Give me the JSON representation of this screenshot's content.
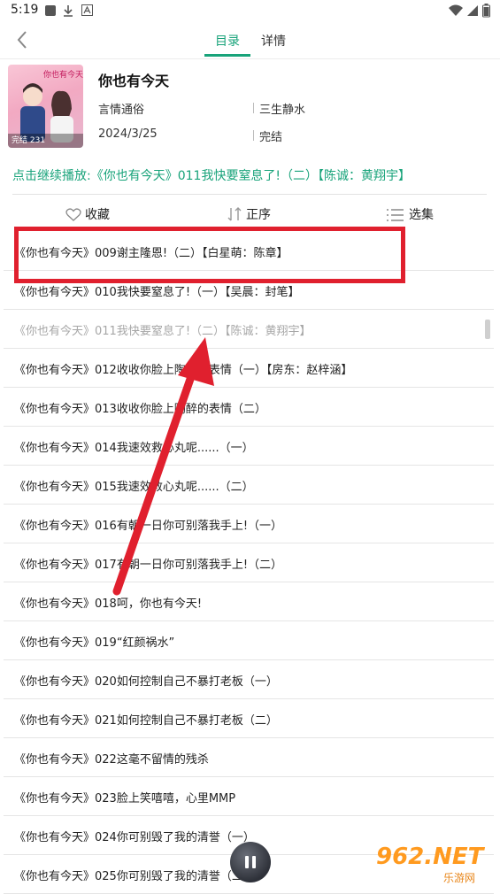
{
  "statusbar": {
    "time": "5:19"
  },
  "nav": {
    "tab_catalog": "目录",
    "tab_details": "详情"
  },
  "book": {
    "title": "你也有今天",
    "genre": "言情通俗",
    "author": "三生静水",
    "date": "2024/3/25",
    "status": "完结",
    "cover_badge": "完结 231"
  },
  "resume_text": "点击继续播放:《你也有今天》011我快要窒息了!（二）【陈诚：黄翔宇】",
  "toolbar": {
    "favorite": "收藏",
    "order": "正序",
    "select": "选集"
  },
  "episodes": [
    "《你也有今天》009谢主隆恩!（二）【白星萌：陈章】",
    "《你也有今天》010我快要窒息了!（一）【吴晨：封笔】",
    "《你也有今天》011我快要窒息了!（二）【陈诚：黄翔宇】",
    "《你也有今天》012收收你脸上陶醉的表情（一）【房东：赵梓涵】",
    "《你也有今天》013收收你脸上陶醉的表情（二）",
    "《你也有今天》014我速效救心丸呢......（一）",
    "《你也有今天》015我速效救心丸呢......（二）",
    "《你也有今天》016有朝一日你可别落我手上!（一）",
    "《你也有今天》017有朝一日你可别落我手上!（二）",
    "《你也有今天》018呵，你也有今天!",
    "《你也有今天》019“红颜祸水”",
    "《你也有今天》020如何控制自己不暴打老板（一）",
    "《你也有今天》021如何控制自己不暴打老板（二）",
    "《你也有今天》022这毫不留情的残杀",
    "《你也有今天》023脸上笑嘻嘻，心里MMP",
    "《你也有今天》024你可别毁了我的清誉（一）",
    "《你也有今天》025你可别毁了我的清誉（二）"
  ],
  "watermark": {
    "logo": "962.NET",
    "sub": "乐游网"
  },
  "colors": {
    "accent": "#18a37a",
    "annotation": "#e0202e"
  }
}
